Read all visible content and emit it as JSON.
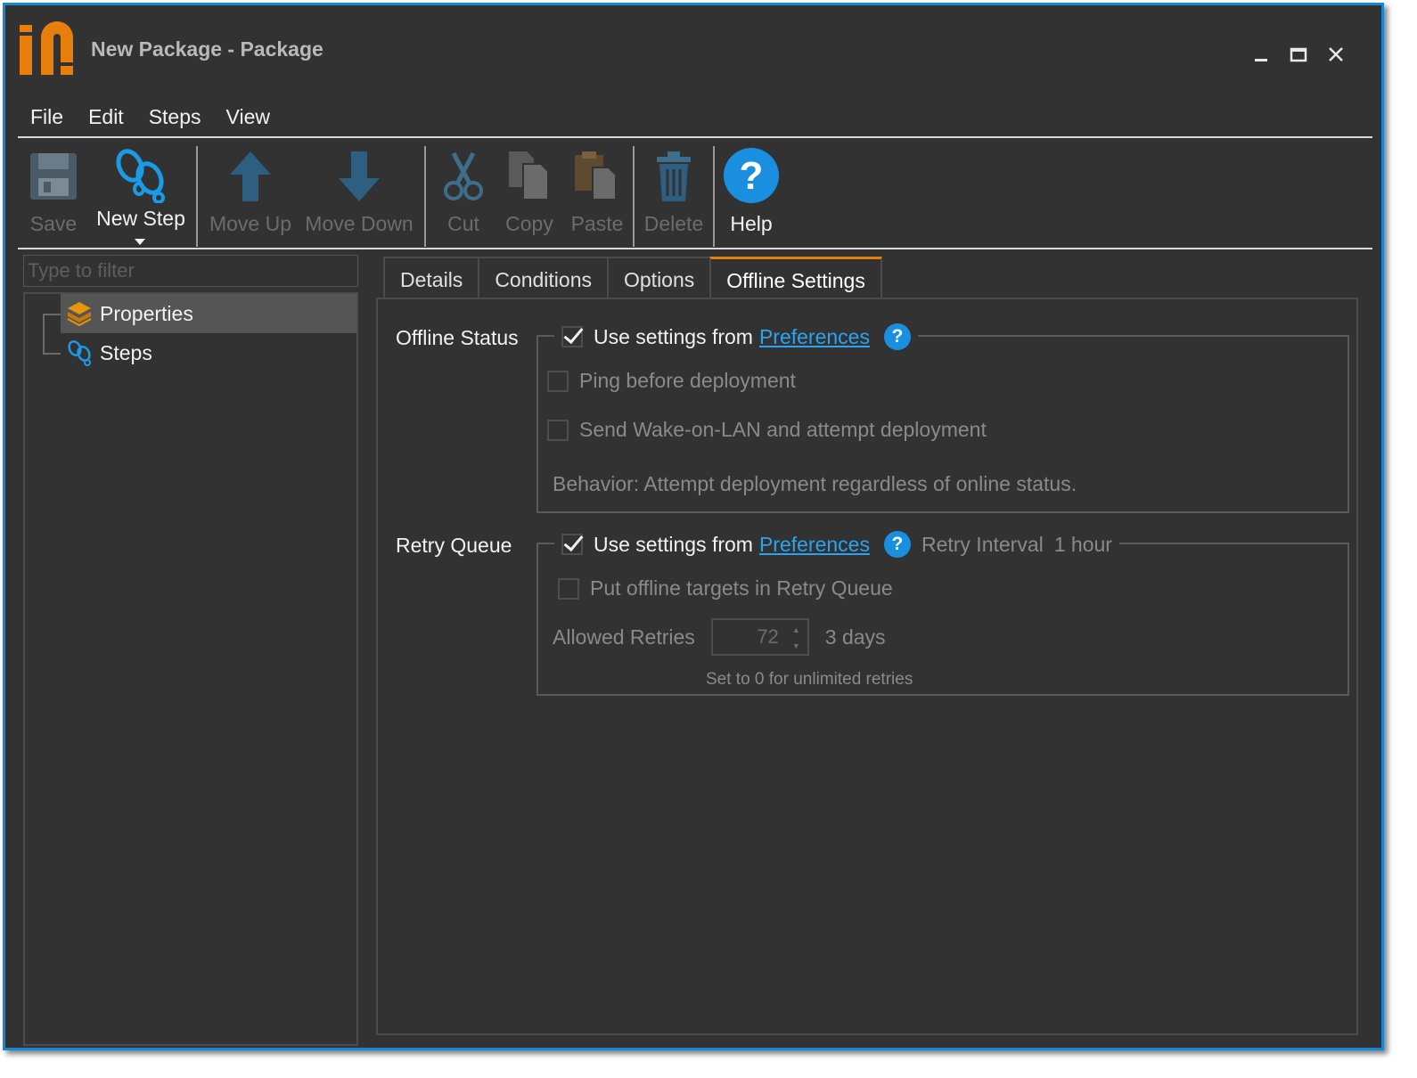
{
  "window": {
    "title": "New Package - Package",
    "controls": [
      "minimize",
      "maximize",
      "close"
    ]
  },
  "menu": [
    "File",
    "Edit",
    "Steps",
    "View"
  ],
  "toolbar": {
    "save": "Save",
    "new_step": "New Step",
    "move_up": "Move Up",
    "move_down": "Move Down",
    "cut": "Cut",
    "copy": "Copy",
    "paste": "Paste",
    "delete": "Delete",
    "help": "Help"
  },
  "sidebar": {
    "filter_placeholder": "Type to filter",
    "items": [
      {
        "label": "Properties",
        "icon": "box-icon",
        "selected": true
      },
      {
        "label": "Steps",
        "icon": "footprints-icon",
        "selected": false
      }
    ]
  },
  "tabs": [
    "Details",
    "Conditions",
    "Options",
    "Offline Settings"
  ],
  "active_tab": "Offline Settings",
  "offline_status": {
    "label": "Offline Status",
    "use_settings_prefix": "Use settings from",
    "preferences_link": "Preferences",
    "use_settings_checked": true,
    "ping": "Ping before deployment",
    "wake": "Send Wake-on-LAN and attempt deployment",
    "behavior": "Behavior: Attempt deployment regardless of online status."
  },
  "retry_queue": {
    "label": "Retry Queue",
    "use_settings_prefix": "Use settings from",
    "preferences_link": "Preferences",
    "use_settings_checked": true,
    "retry_interval_label": "Retry Interval",
    "retry_interval_value": "1 hour",
    "put_offline": "Put offline targets in Retry Queue",
    "allowed_retries_label": "Allowed Retries",
    "allowed_retries_value": "72",
    "allowed_retries_duration": "3 days",
    "hint": "Set to 0 for unlimited retries"
  },
  "colors": {
    "accent": "#e87e0c",
    "link": "#2aa4f0",
    "help": "#1a8fe0",
    "border": "#1488d8"
  }
}
